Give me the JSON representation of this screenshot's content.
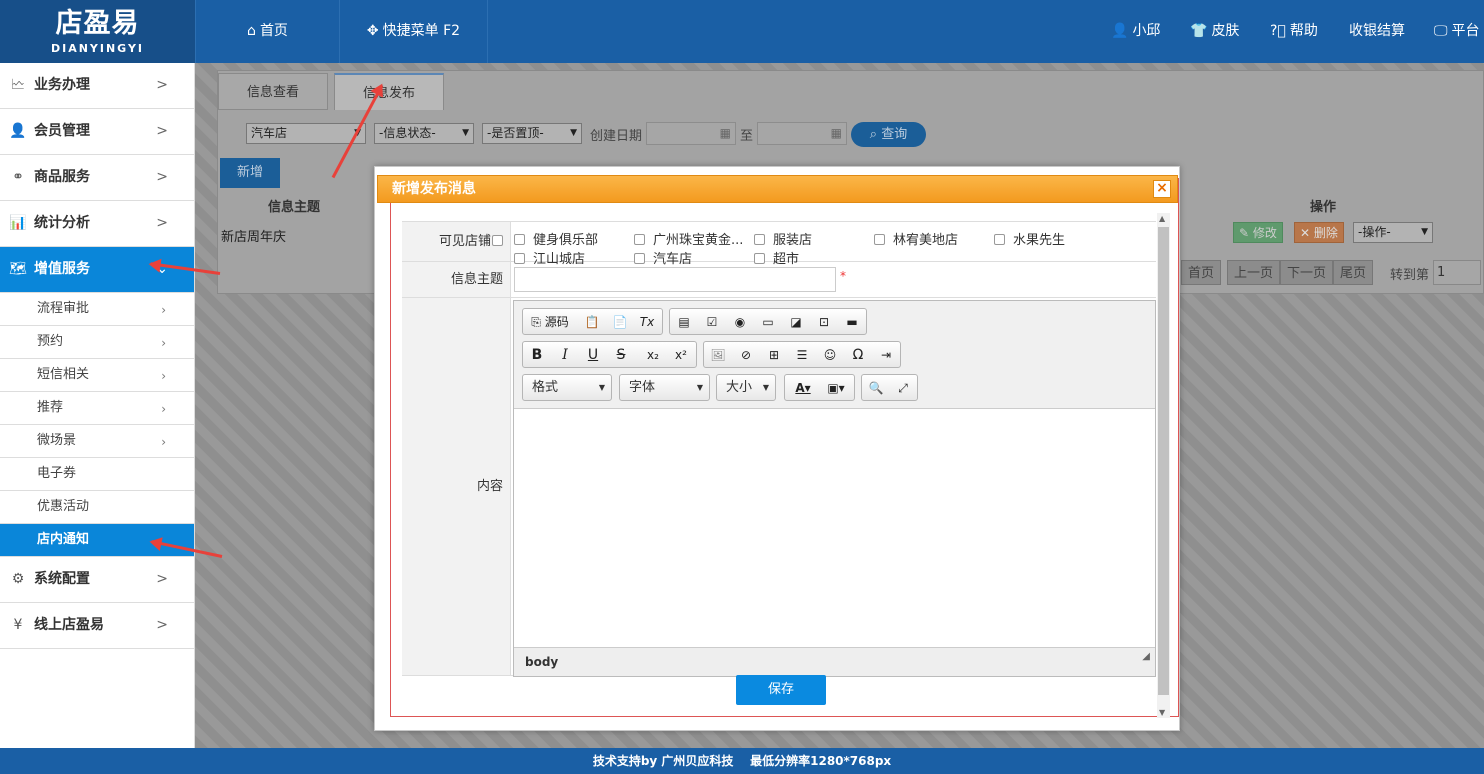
{
  "header": {
    "logo_cn": "店盈易",
    "logo_en": "DIANYINGYI",
    "nav_home": "首页",
    "nav_quick": "快捷菜单 F2",
    "user": "小邱",
    "skin": "皮肤",
    "help": "帮助",
    "cashier": "收银结算",
    "platform": "平台"
  },
  "sidebar": {
    "items": [
      {
        "label": "业务办理",
        "icon": "chart-icon"
      },
      {
        "label": "会员管理",
        "icon": "user-icon"
      },
      {
        "label": "商品服务",
        "icon": "link-icon"
      },
      {
        "label": "统计分析",
        "icon": "monitor-icon"
      },
      {
        "label": "增值服务",
        "icon": "map-icon"
      }
    ],
    "subitems": [
      {
        "label": "流程审批",
        "chev": true
      },
      {
        "label": "预约",
        "chev": true
      },
      {
        "label": "短信相关",
        "chev": true
      },
      {
        "label": "推荐",
        "chev": true
      },
      {
        "label": "微场景",
        "chev": true
      },
      {
        "label": "电子券",
        "chev": false
      },
      {
        "label": "优惠活动",
        "chev": false
      },
      {
        "label": "店内通知",
        "chev": false
      }
    ],
    "bottom": [
      {
        "label": "系统配置",
        "icon": "gear-icon"
      },
      {
        "label": "线上店盈易",
        "icon": "yen-icon"
      }
    ]
  },
  "main": {
    "tabs": [
      "信息查看",
      "信息发布"
    ],
    "filters": {
      "store": "汽车店",
      "status": "-信息状态-",
      "top": "-是否置顶-",
      "date_label": "创建日期",
      "to_label": "至",
      "query": "查询"
    },
    "add_button": "新增",
    "table": {
      "col_subject": "信息主题",
      "col_ops": "操作",
      "row_subject": "新店周年庆",
      "edit": "修改",
      "delete": "删除",
      "ops_select": "-操作-"
    },
    "pager": {
      "first": "首页",
      "prev": "上一页",
      "next": "下一页",
      "last": "尾页",
      "goto": "转到第",
      "page": "1"
    }
  },
  "modal": {
    "title": "新增发布消息",
    "close": "×",
    "visible_stores_label": "可见店铺",
    "stores": [
      "健身俱乐部",
      "广州珠宝黄金...",
      "服装店",
      "林宥美地店",
      "水果先生",
      "江山城店",
      "汽车店",
      "超市"
    ],
    "subject_label": "信息主题",
    "required_mark": "*",
    "content_label": "内容",
    "editor": {
      "source": "源码",
      "format": "格式",
      "font": "字体",
      "size": "大小",
      "status_path": "body"
    },
    "save": "保存"
  },
  "footer": {
    "text": "技术支持by 广州贝应科技    最低分辨率1280*768px"
  }
}
